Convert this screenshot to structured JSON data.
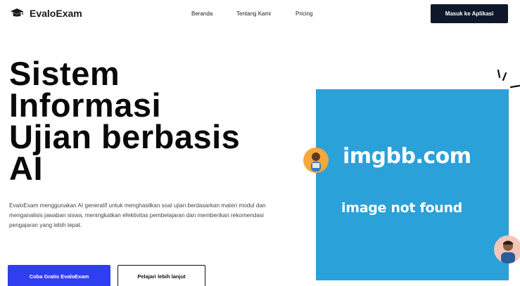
{
  "brand": {
    "name": "EvaloExam",
    "icon": "graduation-cap-icon"
  },
  "nav": {
    "links": [
      "Beranda",
      "Tentang Kami",
      "Pricing"
    ],
    "login_label": "Masuk ke Aplikasi"
  },
  "hero": {
    "title_lines": [
      "Sistem",
      "Informasi",
      "Ujian berbasis",
      "AI"
    ],
    "description": "EvaloExam menggunakan AI generatif untuk menghasilkan soal ujian berdasarkan materi modul dan menganalisis jawaban siswa, meningkatkan efektivitas pembelajaran dan memberikan rekomendasi pengajaran yang lebih tepat.",
    "primary_cta": "Coba Gratis EvaloExam",
    "secondary_cta": "Pelajari lebih lanjut"
  },
  "image_placeholder": {
    "host": "imgbb.com",
    "message": "image not found",
    "background": "#2aa1d9"
  },
  "colors": {
    "primary": "#2f3ef0",
    "dark": "#0f172a"
  }
}
